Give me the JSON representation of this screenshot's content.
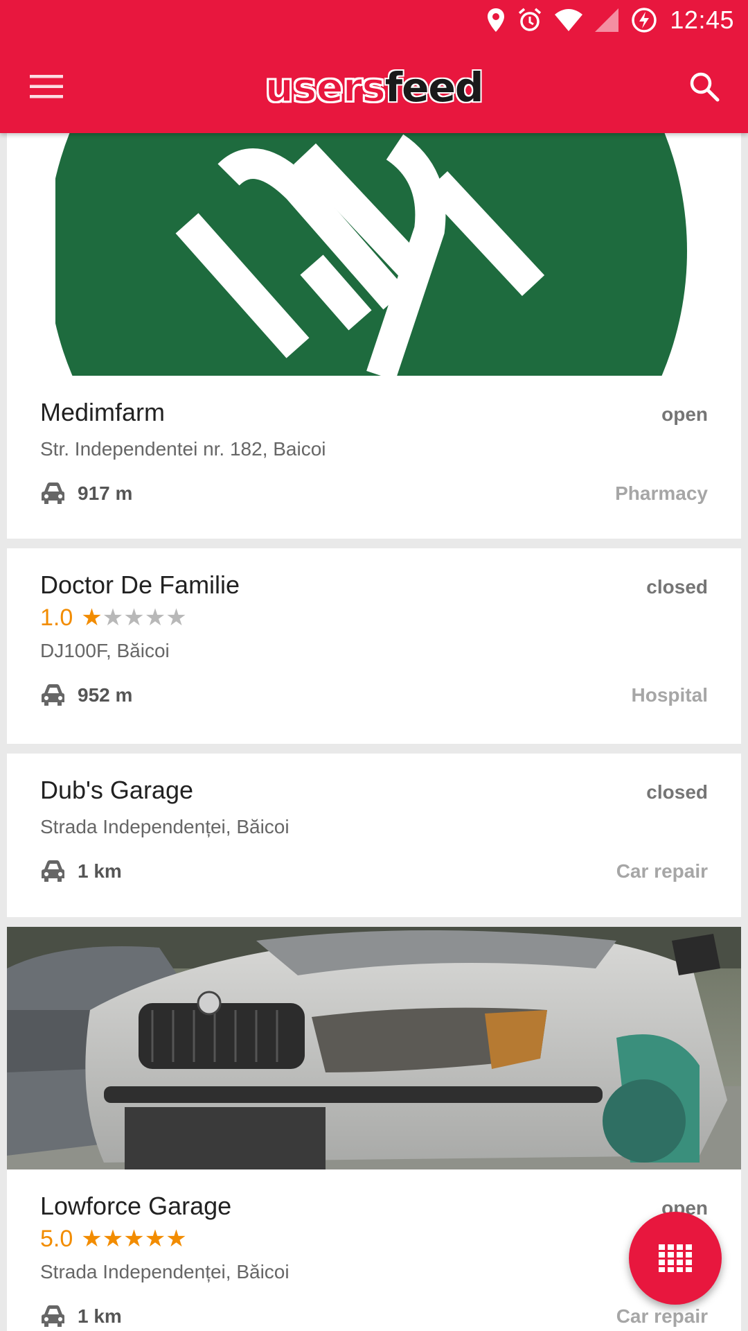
{
  "status_bar": {
    "time": "12:45"
  },
  "app": {
    "logo_part1": "users",
    "logo_part2": "feed",
    "brand_color": "#e8173e"
  },
  "places": [
    {
      "name": "Medimfarm",
      "status": "open",
      "address": "Str. Independentei nr. 182, Baicoi",
      "distance": "917 m",
      "category": "Pharmacy",
      "logo_color": "#1e6b3e"
    },
    {
      "name": "Doctor De Familie",
      "status": "closed",
      "rating": "1.0",
      "rating_value": 1,
      "address": "DJ100F, Băicoi",
      "distance": "952 m",
      "category": "Hospital"
    },
    {
      "name": "Dub's Garage",
      "status": "closed",
      "address": "Strada Independenței, Băicoi",
      "distance": "1 km",
      "category": "Car repair"
    },
    {
      "name": "Lowforce Garage",
      "status": "open",
      "rating": "5.0",
      "rating_value": 5,
      "address": "Strada Independenței, Băicoi",
      "distance": "1 km",
      "category": "Car repair"
    }
  ],
  "icons": {
    "menu": "menu-icon",
    "search": "search-icon",
    "car": "car-icon",
    "grid": "grid-icon",
    "star": "star-icon"
  },
  "colors": {
    "rating": "#f28c00",
    "appbar": "#e8173e"
  }
}
